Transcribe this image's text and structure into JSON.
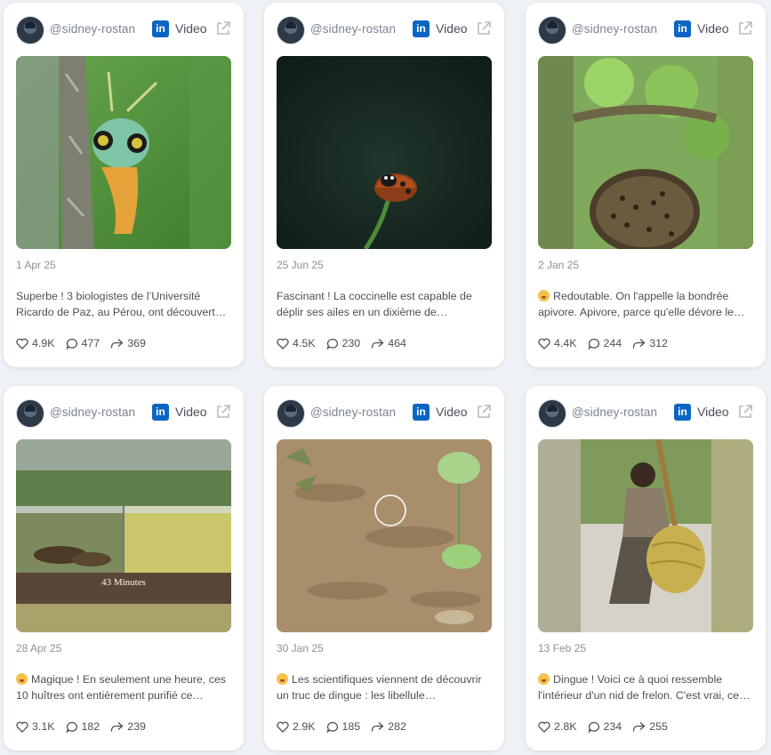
{
  "colors": {
    "linkedin": "#0a66c2",
    "background": "#eef1f5",
    "card": "#ffffff"
  },
  "cards": [
    {
      "handle": "@sidney-rostan",
      "network_icon": "linkedin-icon",
      "type": "Video",
      "date": "1 Apr 25",
      "excerpt": "Superbe ! 3 biologistes de l’Université Ricardo de Paz, au Pérou, ont découvert…",
      "has_emoji": false,
      "likes": "4.9K",
      "comments": "477",
      "shares": "369"
    },
    {
      "handle": "@sidney-rostan",
      "network_icon": "linkedin-icon",
      "type": "Video",
      "date": "25 Jun 25",
      "excerpt": "Fascinant ! La coccinelle est capable de déplir ses ailes en un dixième de…",
      "has_emoji": false,
      "likes": "4.5K",
      "comments": "230",
      "shares": "464"
    },
    {
      "handle": "@sidney-rostan",
      "network_icon": "linkedin-icon",
      "type": "Video",
      "date": "2 Jan 25",
      "excerpt": "Redoutable. On l'appelle la bondrée apivore. Apivore, parce qu'elle dévore le…",
      "has_emoji": true,
      "likes": "4.4K",
      "comments": "244",
      "shares": "312"
    },
    {
      "handle": "@sidney-rostan",
      "network_icon": "linkedin-icon",
      "type": "Video",
      "date": "28 Apr 25",
      "excerpt": "Magique ! En seulement une heure, ces 10 huîtres ont entièrement purifié ce…",
      "has_emoji": true,
      "media_caption": "43 Minutes",
      "likes": "3.1K",
      "comments": "182",
      "shares": "239"
    },
    {
      "handle": "@sidney-rostan",
      "network_icon": "linkedin-icon",
      "type": "Video",
      "date": "30 Jan 25",
      "excerpt": "Les scientifiques viennent de découvrir un truc de dingue : les libellule…",
      "has_emoji": true,
      "likes": "2.9K",
      "comments": "185",
      "shares": "282"
    },
    {
      "handle": "@sidney-rostan",
      "network_icon": "linkedin-icon",
      "type": "Video",
      "date": "13 Feb 25",
      "excerpt": "Dingue ! Voici ce à quoi ressemble l'intérieur d'un nid de frelon. C'est vrai, ce…",
      "has_emoji": true,
      "likes": "2.8K",
      "comments": "234",
      "shares": "255"
    }
  ]
}
